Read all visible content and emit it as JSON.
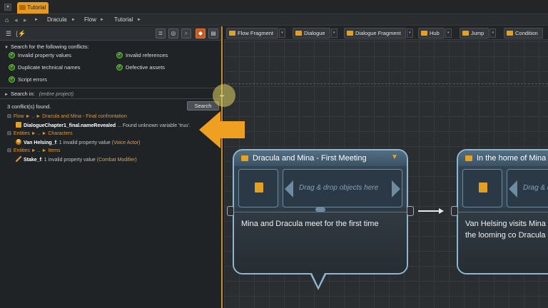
{
  "window": {
    "tab_label": "Tutorial"
  },
  "breadcrumb": {
    "items": [
      "Dracula",
      "Flow",
      "Tutorial"
    ]
  },
  "search_panel": {
    "conflicts_header": "Search for the following conflicts:",
    "checks": [
      {
        "label": "Invalid property values",
        "checked": true
      },
      {
        "label": "Invalid references",
        "checked": true
      },
      {
        "label": "Duplicate technical names",
        "checked": true
      },
      {
        "label": "Defective assets",
        "checked": true
      },
      {
        "label": "Script errors",
        "checked": true
      }
    ],
    "search_in_label": "Search in:",
    "search_in_value": "(entire project)",
    "result_count": "3 conflict(s) found.",
    "search_button": "Search",
    "results": [
      {
        "category": "Flow ► .. ► Dracula and Mina - Final confrontation",
        "item_name": "DialogueChapter1_final.nameRevealed",
        "item_sep": " ... ",
        "detail": "Found unknown variable 'truu'."
      },
      {
        "category": "Entities ► .. ► Characters",
        "item_name": "Van Helsing_f",
        "item_sep": ": ",
        "detail": "1 invalid property value",
        "value": "(Voice Actor)"
      },
      {
        "category": "Entities ► .. ► Items",
        "item_name": "Stake_f",
        "item_sep": ": ",
        "detail": "1 invalid property value",
        "value": "(Combat Modifier)"
      }
    ]
  },
  "palette": {
    "items": [
      "Flow Fragment",
      "Dialogue",
      "Dialogue Fragment",
      "Hub",
      "Jump",
      "Condition"
    ]
  },
  "nodes": [
    {
      "title": "Dracula and Mina - First Meeting",
      "drop_hint": "Drag & drop objects here",
      "text": "Mina and Dracula meet for the first time"
    },
    {
      "title": "In the home of Mina",
      "drop_hint": "Drag & drop objects here",
      "text": "Van Helsing visits Mina to discuss the looming co Dracula"
    }
  ],
  "colors": {
    "accent": "#e69a1f",
    "node_border": "#8fb6d1",
    "check_green": "#6bbf3a"
  }
}
